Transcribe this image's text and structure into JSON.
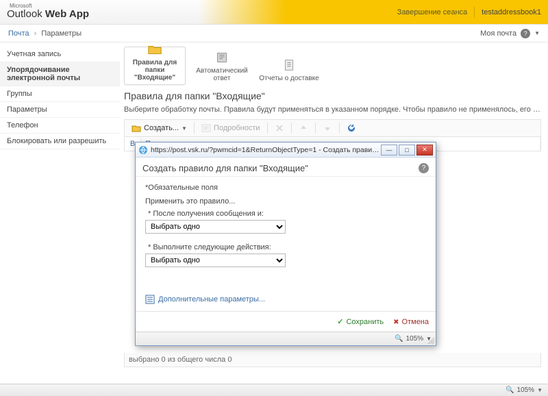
{
  "header": {
    "brand_pre": "Microsoft",
    "brand_main": "Outlook ",
    "brand_bold": "Web App",
    "signout": "Завершение сеанса",
    "user": "testaddressbook1"
  },
  "breadcrumb": {
    "root": "Почта",
    "current": "Параметры",
    "right_label": "Моя почта"
  },
  "sidebar": {
    "items": [
      {
        "label": "Учетная запись"
      },
      {
        "label": "Упорядочивание электронной почты"
      },
      {
        "label": "Группы"
      },
      {
        "label": "Параметры"
      },
      {
        "label": "Телефон"
      },
      {
        "label": "Блокировать или разрешить"
      }
    ],
    "selected_index": 1
  },
  "tabs": {
    "items": [
      {
        "label": "Правила для папки \"Входящие\""
      },
      {
        "label": "Автоматический ответ"
      },
      {
        "label": "Отчеты о доставке"
      }
    ],
    "selected_index": 0
  },
  "section": {
    "title": "Правила для папки \"Входящие\"",
    "desc": "Выберите обработку почты. Правила будут применяться в указанном порядке. Чтобы правило не применялось, его нужно отключить или удалить."
  },
  "toolbar": {
    "create": "Создать...",
    "details": "Подробности"
  },
  "grid": {
    "col_enabled": "В",
    "col_rule": "Правило"
  },
  "status": "выбрано 0 из общего числа 0",
  "bottom": {
    "zoom": "105%"
  },
  "popup": {
    "window_title": "https://post.vsk.ru/?pwmcid=1&ReturnObjectType=1 - Создать правило для папки \"Входящие\" - Windows Inte...",
    "title": "Создать правило для папки \"Входящие\"",
    "required": "*Обязательные поля",
    "apply_label": "Применить это правило...",
    "field1_label": "* После получения сообщения и:",
    "field1_value": "Выбрать одно",
    "field2_label": "* Выполните следующие действия:",
    "field2_value": "Выбрать одно",
    "more": "Дополнительные параметры...",
    "save": "Сохранить",
    "cancel": "Отмена",
    "zoom": "105%"
  }
}
